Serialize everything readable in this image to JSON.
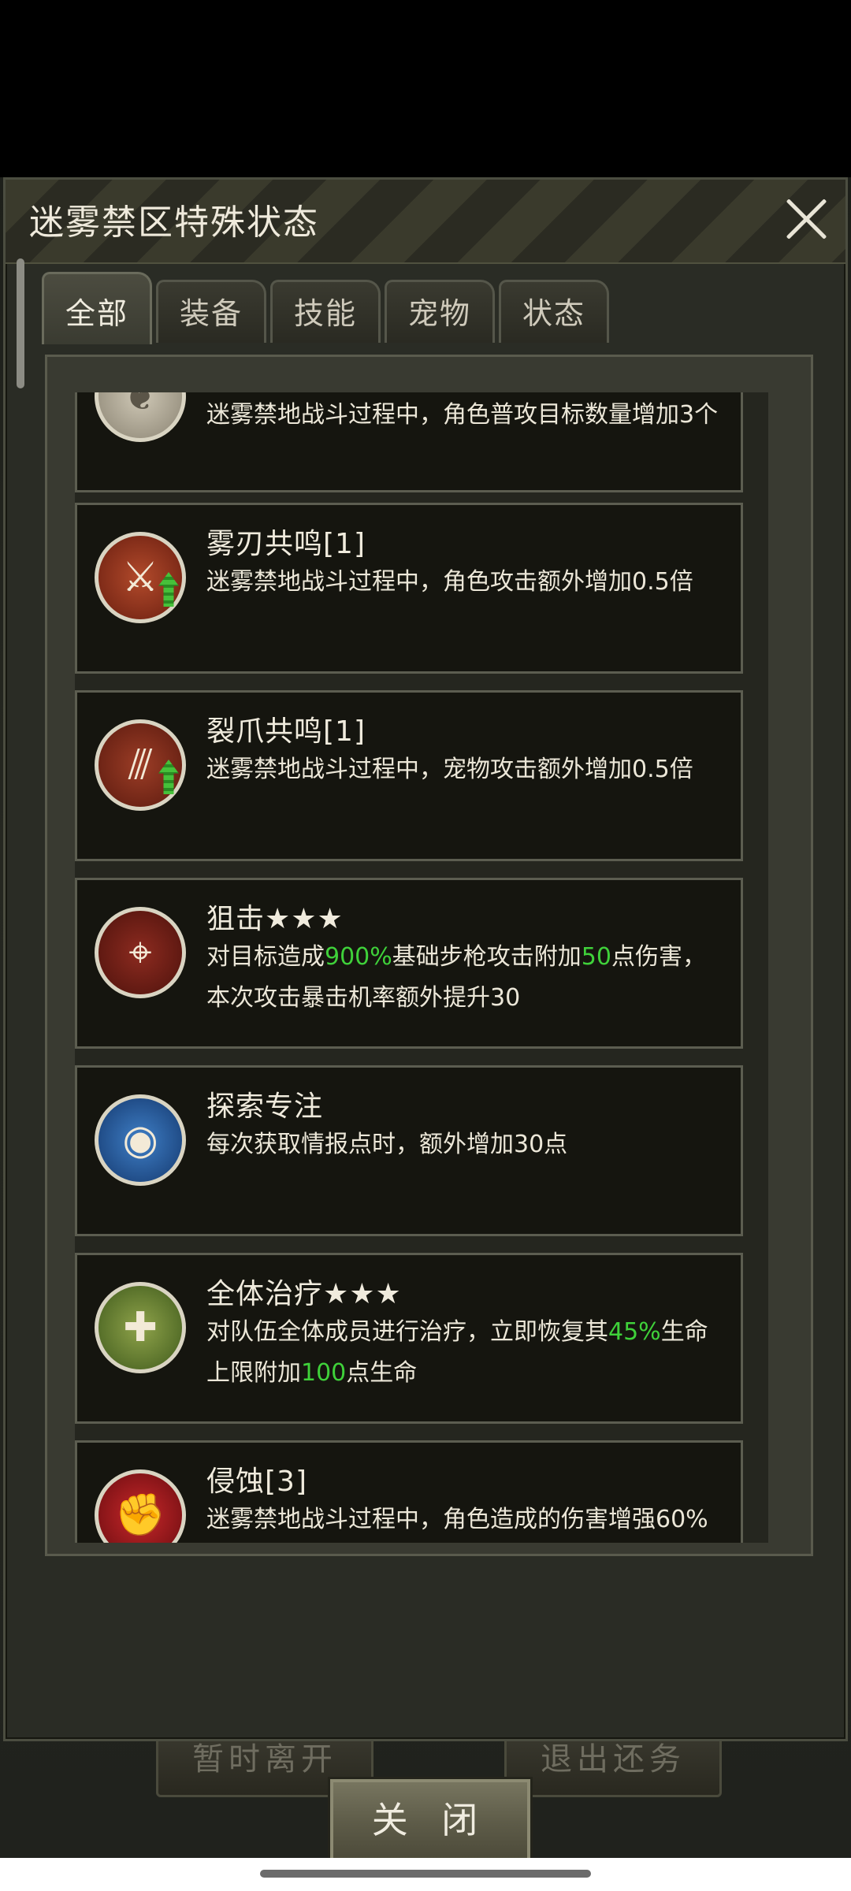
{
  "dialog": {
    "title": "迷雾禁区特殊状态",
    "close_icon": "close-icon",
    "tabs": [
      {
        "label": "全部",
        "active": true
      },
      {
        "label": "装备",
        "active": false
      },
      {
        "label": "技能",
        "active": false
      },
      {
        "label": "宠物",
        "active": false
      },
      {
        "label": "状态",
        "active": false
      }
    ],
    "close_button": "关 闭"
  },
  "cards": [
    {
      "name": "",
      "desc": "迷雾禁地战斗过程中，角色普攻目标数量增加3个",
      "icon": "rune-knot-icon"
    },
    {
      "name": "雾刃共鸣[1]",
      "desc": "迷雾禁地战斗过程中，角色攻击额外增加0.5倍",
      "icon": "sword-buff-icon"
    },
    {
      "name": "裂爪共鸣[1]",
      "desc": "迷雾禁地战斗过程中，宠物攻击额外增加0.5倍",
      "icon": "claw-buff-icon"
    },
    {
      "name": "狙击★★★",
      "desc_parts": [
        "对目标造成",
        "900%",
        "基础步枪攻击附加",
        "50",
        "点伤害，本次攻击暴击机率额外提升30"
      ],
      "icon": "crosshair-icon"
    },
    {
      "name": "探索专注",
      "desc": "每次获取情报点时，额外增加30点",
      "icon": "magnifier-eye-icon"
    },
    {
      "name": "全体治疗★★★",
      "desc_parts": [
        "对队伍全体成员进行治疗，立即恢复其",
        "45%",
        "生命上限附加",
        "100",
        "点生命"
      ],
      "icon": "heal-icon"
    },
    {
      "name": "侵蚀[3]",
      "desc": "迷雾禁地战斗过程中，角色造成的伤害增强60%",
      "icon": "fist-icon"
    }
  ],
  "background_buttons": [
    "暂时离开",
    "退出还务"
  ],
  "colors": {
    "highlight": "#3fd13a",
    "panel": "#15150f",
    "border": "#5c5d50"
  }
}
